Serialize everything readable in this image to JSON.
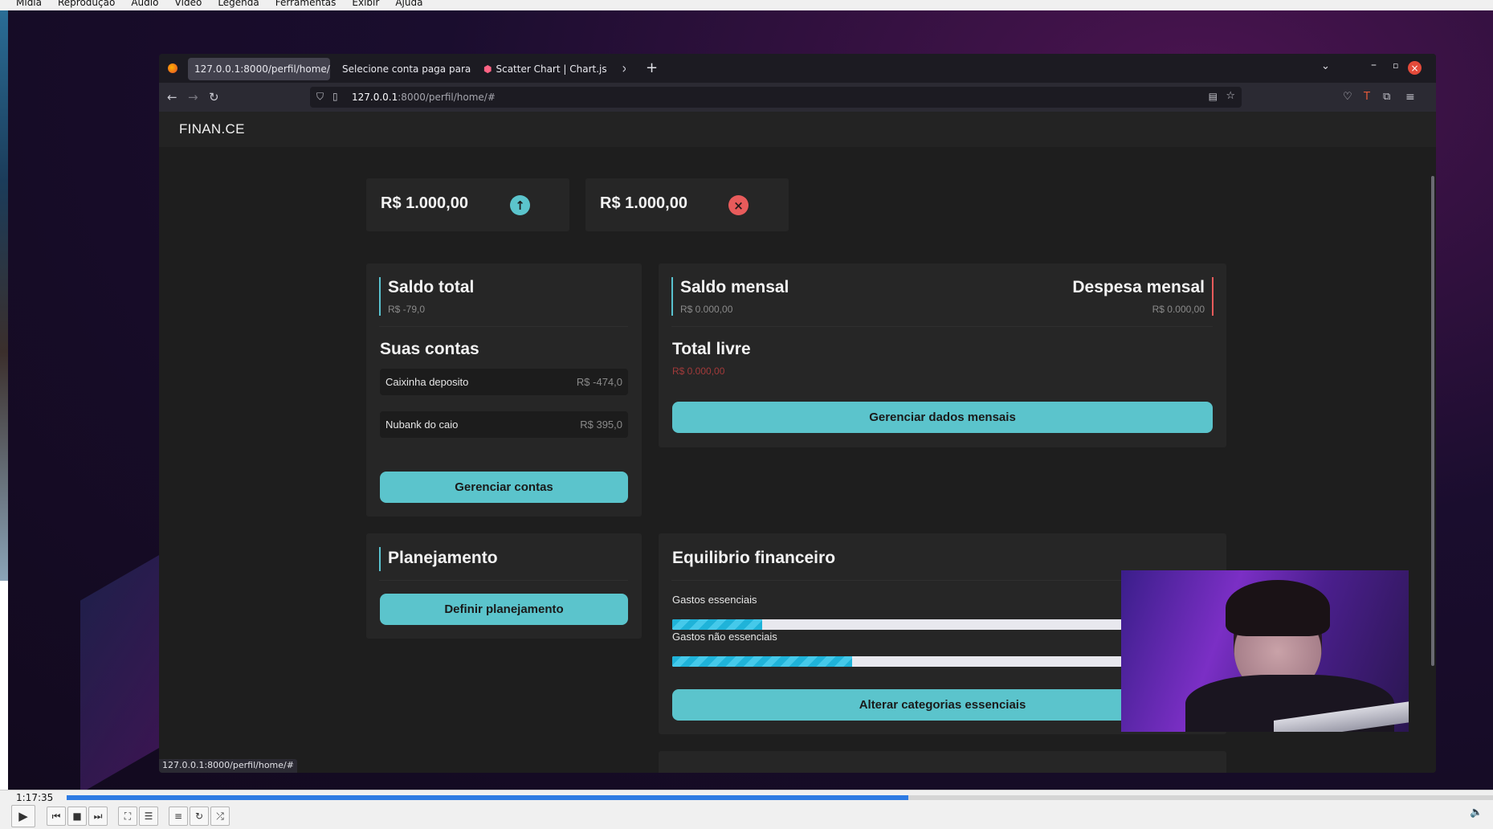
{
  "vlc": {
    "menu": [
      "Mídia",
      "Reprodução",
      "Áudio",
      "Vídeo",
      "Legenda",
      "Ferramentas",
      "Exibir",
      "Ajuda"
    ],
    "time": "1:17:35",
    "progress_fraction": 0.59
  },
  "browser": {
    "tabs": [
      {
        "label": "127.0.0.1:8000/perfil/home/"
      },
      {
        "label": "Selecione conta paga para m"
      },
      {
        "label": "Scatter Chart | Chart.js"
      }
    ],
    "url_host": "127.0.0.1",
    "url_rest": ":8000/perfil/home/#",
    "status_link": "127.0.0.1:8000/perfil/home/#"
  },
  "app": {
    "brand": "FINAN.CE",
    "income_card": {
      "value": "R$ 1.000,00"
    },
    "expense_card": {
      "value": "R$ 1.000,00"
    },
    "saldo_total": {
      "title": "Saldo total",
      "value": "R$ -79,0"
    },
    "contas": {
      "title": "Suas contas",
      "items": [
        {
          "name": "Caixinha deposito",
          "value": "R$ -474,0"
        },
        {
          "name": "Nubank do caio",
          "value": "R$ 395,0"
        }
      ],
      "button": "Gerenciar contas"
    },
    "mensal": {
      "saldo_title": "Saldo mensal",
      "saldo_value": "R$ 0.000,00",
      "despesa_title": "Despesa mensal",
      "despesa_value": "R$ 0.000,00",
      "livre_title": "Total livre",
      "livre_value": "R$ 0.000,00",
      "button": "Gerenciar dados mensais"
    },
    "planejamento": {
      "title": "Planejamento",
      "button": "Definir planejamento"
    },
    "equilibrio": {
      "title": "Equilibrio financeiro",
      "bars": [
        {
          "label": "Gastos essenciais",
          "fraction": 0.2
        },
        {
          "label": "Gastos não essenciais",
          "fraction": 0.4
        }
      ],
      "button": "Alterar categorias essenciais"
    }
  },
  "colors": {
    "accent": "#5bc4cc",
    "income_icon": "#5bc4cc",
    "expense_icon": "#e85b5b"
  }
}
